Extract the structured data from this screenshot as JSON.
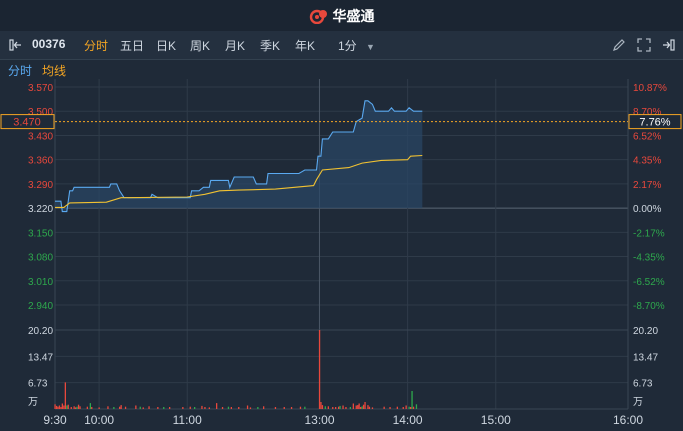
{
  "app": {
    "title": "华盛通"
  },
  "toolbar": {
    "stock_code": "00376",
    "periods": [
      "分时",
      "五日",
      "日K",
      "周K",
      "月K",
      "季K",
      "年K"
    ],
    "active_period": "分时",
    "interval": "1分"
  },
  "subtabs": {
    "timeshare": "分时",
    "avg_line": "均线"
  },
  "crosshair": {
    "price": "3.470",
    "percent": "7.76%"
  },
  "colors": {
    "up": "#e8483c",
    "down": "#2ea84d",
    "neutral": "#cfd7e0",
    "price_line": "#5aa9f0",
    "avg_line": "#f1c232",
    "accent": "#f5a623"
  },
  "chart_data": {
    "type": "line",
    "price_axis": {
      "ticks": [
        "3.570",
        "3.500",
        "3.430",
        "3.360",
        "3.290",
        "3.220",
        "3.150",
        "3.080",
        "3.010",
        "2.940"
      ],
      "values": [
        3.57,
        3.5,
        3.43,
        3.36,
        3.29,
        3.22,
        3.15,
        3.08,
        3.01,
        2.94
      ],
      "prev_close": 3.22
    },
    "percent_axis": {
      "ticks": [
        "10.87%",
        "8.70%",
        "6.52%",
        "4.35%",
        "2.17%",
        "0.00%",
        "-2.17%",
        "-4.35%",
        "-6.52%",
        "-8.70%"
      ]
    },
    "volume_axis": {
      "ticks": [
        "20.20",
        "13.47",
        "6.73",
        "万"
      ],
      "max": 20.2
    },
    "time_labels": [
      "9:30",
      "10:00",
      "11:00",
      "13:00",
      "14:00",
      "15:00",
      "16:00"
    ],
    "series": [
      {
        "id": "price",
        "points": [
          [
            0,
            3.24
          ],
          [
            4,
            3.24
          ],
          [
            5,
            3.21
          ],
          [
            8,
            3.21
          ],
          [
            10,
            3.27
          ],
          [
            12,
            3.27
          ],
          [
            13,
            3.28
          ],
          [
            37,
            3.28
          ],
          [
            38,
            3.29
          ],
          [
            42,
            3.29
          ],
          [
            44,
            3.27
          ],
          [
            47,
            3.25
          ],
          [
            65,
            3.25
          ],
          [
            66,
            3.26
          ],
          [
            70,
            3.25
          ],
          [
            92,
            3.25
          ],
          [
            93,
            3.27
          ],
          [
            98,
            3.27
          ],
          [
            101,
            3.28
          ],
          [
            105,
            3.28
          ],
          [
            106,
            3.3
          ],
          [
            118,
            3.3
          ],
          [
            119,
            3.28
          ],
          [
            122,
            3.31
          ],
          [
            135,
            3.31
          ],
          [
            137,
            3.29
          ],
          [
            144,
            3.29
          ],
          [
            145,
            3.32
          ],
          [
            156,
            3.32
          ],
          [
            166,
            3.32
          ],
          [
            170,
            3.33
          ],
          [
            178,
            3.33
          ],
          [
            179,
            3.37
          ],
          [
            181,
            3.37
          ],
          [
            182,
            3.42
          ],
          [
            186,
            3.42
          ],
          [
            189,
            3.44
          ],
          [
            203,
            3.44
          ],
          [
            205,
            3.47
          ],
          [
            209,
            3.48
          ],
          [
            211,
            3.53
          ],
          [
            213,
            3.53
          ],
          [
            216,
            3.52
          ],
          [
            218,
            3.5
          ],
          [
            227,
            3.5
          ],
          [
            229,
            3.51
          ],
          [
            231,
            3.5
          ],
          [
            239,
            3.5
          ],
          [
            241,
            3.51
          ],
          [
            244,
            3.5
          ],
          [
            250,
            3.5
          ]
        ]
      },
      {
        "id": "average",
        "points": [
          [
            0,
            3.222
          ],
          [
            6,
            3.222
          ],
          [
            10,
            3.235
          ],
          [
            35,
            3.237
          ],
          [
            45,
            3.25
          ],
          [
            90,
            3.252
          ],
          [
            102,
            3.26
          ],
          [
            112,
            3.27
          ],
          [
            125,
            3.272
          ],
          [
            150,
            3.275
          ],
          [
            176,
            3.285
          ],
          [
            178,
            3.302
          ],
          [
            182,
            3.33
          ],
          [
            200,
            3.337
          ],
          [
            209,
            3.35
          ],
          [
            222,
            3.358
          ],
          [
            240,
            3.36
          ],
          [
            242,
            3.37
          ],
          [
            250,
            3.372
          ]
        ]
      }
    ],
    "volume_up": [
      [
        0,
        1.2
      ],
      [
        1,
        0.8
      ],
      [
        2,
        0.6
      ],
      [
        3,
        0.9
      ],
      [
        4,
        0.5
      ],
      [
        5,
        1.4
      ],
      [
        6,
        0.9
      ],
      [
        7,
        6.8
      ],
      [
        9,
        1.1
      ],
      [
        11,
        0.5
      ],
      [
        13,
        0.7
      ],
      [
        14,
        0.4
      ],
      [
        16,
        1.1
      ],
      [
        17,
        0.7
      ],
      [
        22,
        0.6
      ],
      [
        25,
        0.5
      ],
      [
        30,
        0.4
      ],
      [
        36,
        0.7
      ],
      [
        44,
        0.6
      ],
      [
        45,
        1.0
      ],
      [
        48,
        0.6
      ],
      [
        55,
        0.9
      ],
      [
        60,
        0.4
      ],
      [
        64,
        0.7
      ],
      [
        70,
        0.5
      ],
      [
        78,
        0.5
      ],
      [
        87,
        0.5
      ],
      [
        92,
        0.6
      ],
      [
        100,
        0.8
      ],
      [
        102,
        0.5
      ],
      [
        105,
        0.4
      ],
      [
        110,
        1.5
      ],
      [
        114,
        0.5
      ],
      [
        120,
        0.5
      ],
      [
        125,
        0.5
      ],
      [
        131,
        0.9
      ],
      [
        133,
        0.4
      ],
      [
        142,
        0.7
      ],
      [
        150,
        0.5
      ],
      [
        156,
        0.5
      ],
      [
        161,
        0.5
      ],
      [
        167,
        0.6
      ],
      [
        180,
        20.2
      ],
      [
        181,
        1.8
      ],
      [
        182,
        1.0
      ],
      [
        186,
        0.7
      ],
      [
        189,
        0.5
      ],
      [
        191,
        0.5
      ],
      [
        193,
        0.6
      ],
      [
        196,
        0.9
      ],
      [
        198,
        0.5
      ],
      [
        203,
        1.4
      ],
      [
        205,
        0.9
      ],
      [
        206,
        1.0
      ],
      [
        207,
        1.4
      ],
      [
        208,
        0.5
      ],
      [
        210,
        1.1
      ],
      [
        211,
        1.8
      ],
      [
        213,
        1.0
      ],
      [
        214,
        0.6
      ],
      [
        216,
        0.4
      ],
      [
        224,
        0.6
      ],
      [
        228,
        0.5
      ],
      [
        233,
        0.6
      ],
      [
        237,
        0.5
      ],
      [
        239,
        0.9
      ],
      [
        242,
        0.5
      ],
      [
        244,
        0.6
      ]
    ],
    "volume_down": [
      [
        8,
        0.9
      ],
      [
        15,
        0.6
      ],
      [
        24,
        1.5
      ],
      [
        40,
        0.5
      ],
      [
        58,
        0.6
      ],
      [
        74,
        0.5
      ],
      [
        95,
        0.5
      ],
      [
        118,
        0.6
      ],
      [
        138,
        0.5
      ],
      [
        170,
        0.6
      ],
      [
        184,
        0.7
      ],
      [
        194,
        0.8
      ],
      [
        201,
        0.5
      ],
      [
        209,
        0.7
      ],
      [
        241,
        0.6
      ],
      [
        243,
        4.6
      ],
      [
        246,
        1.2
      ]
    ]
  }
}
